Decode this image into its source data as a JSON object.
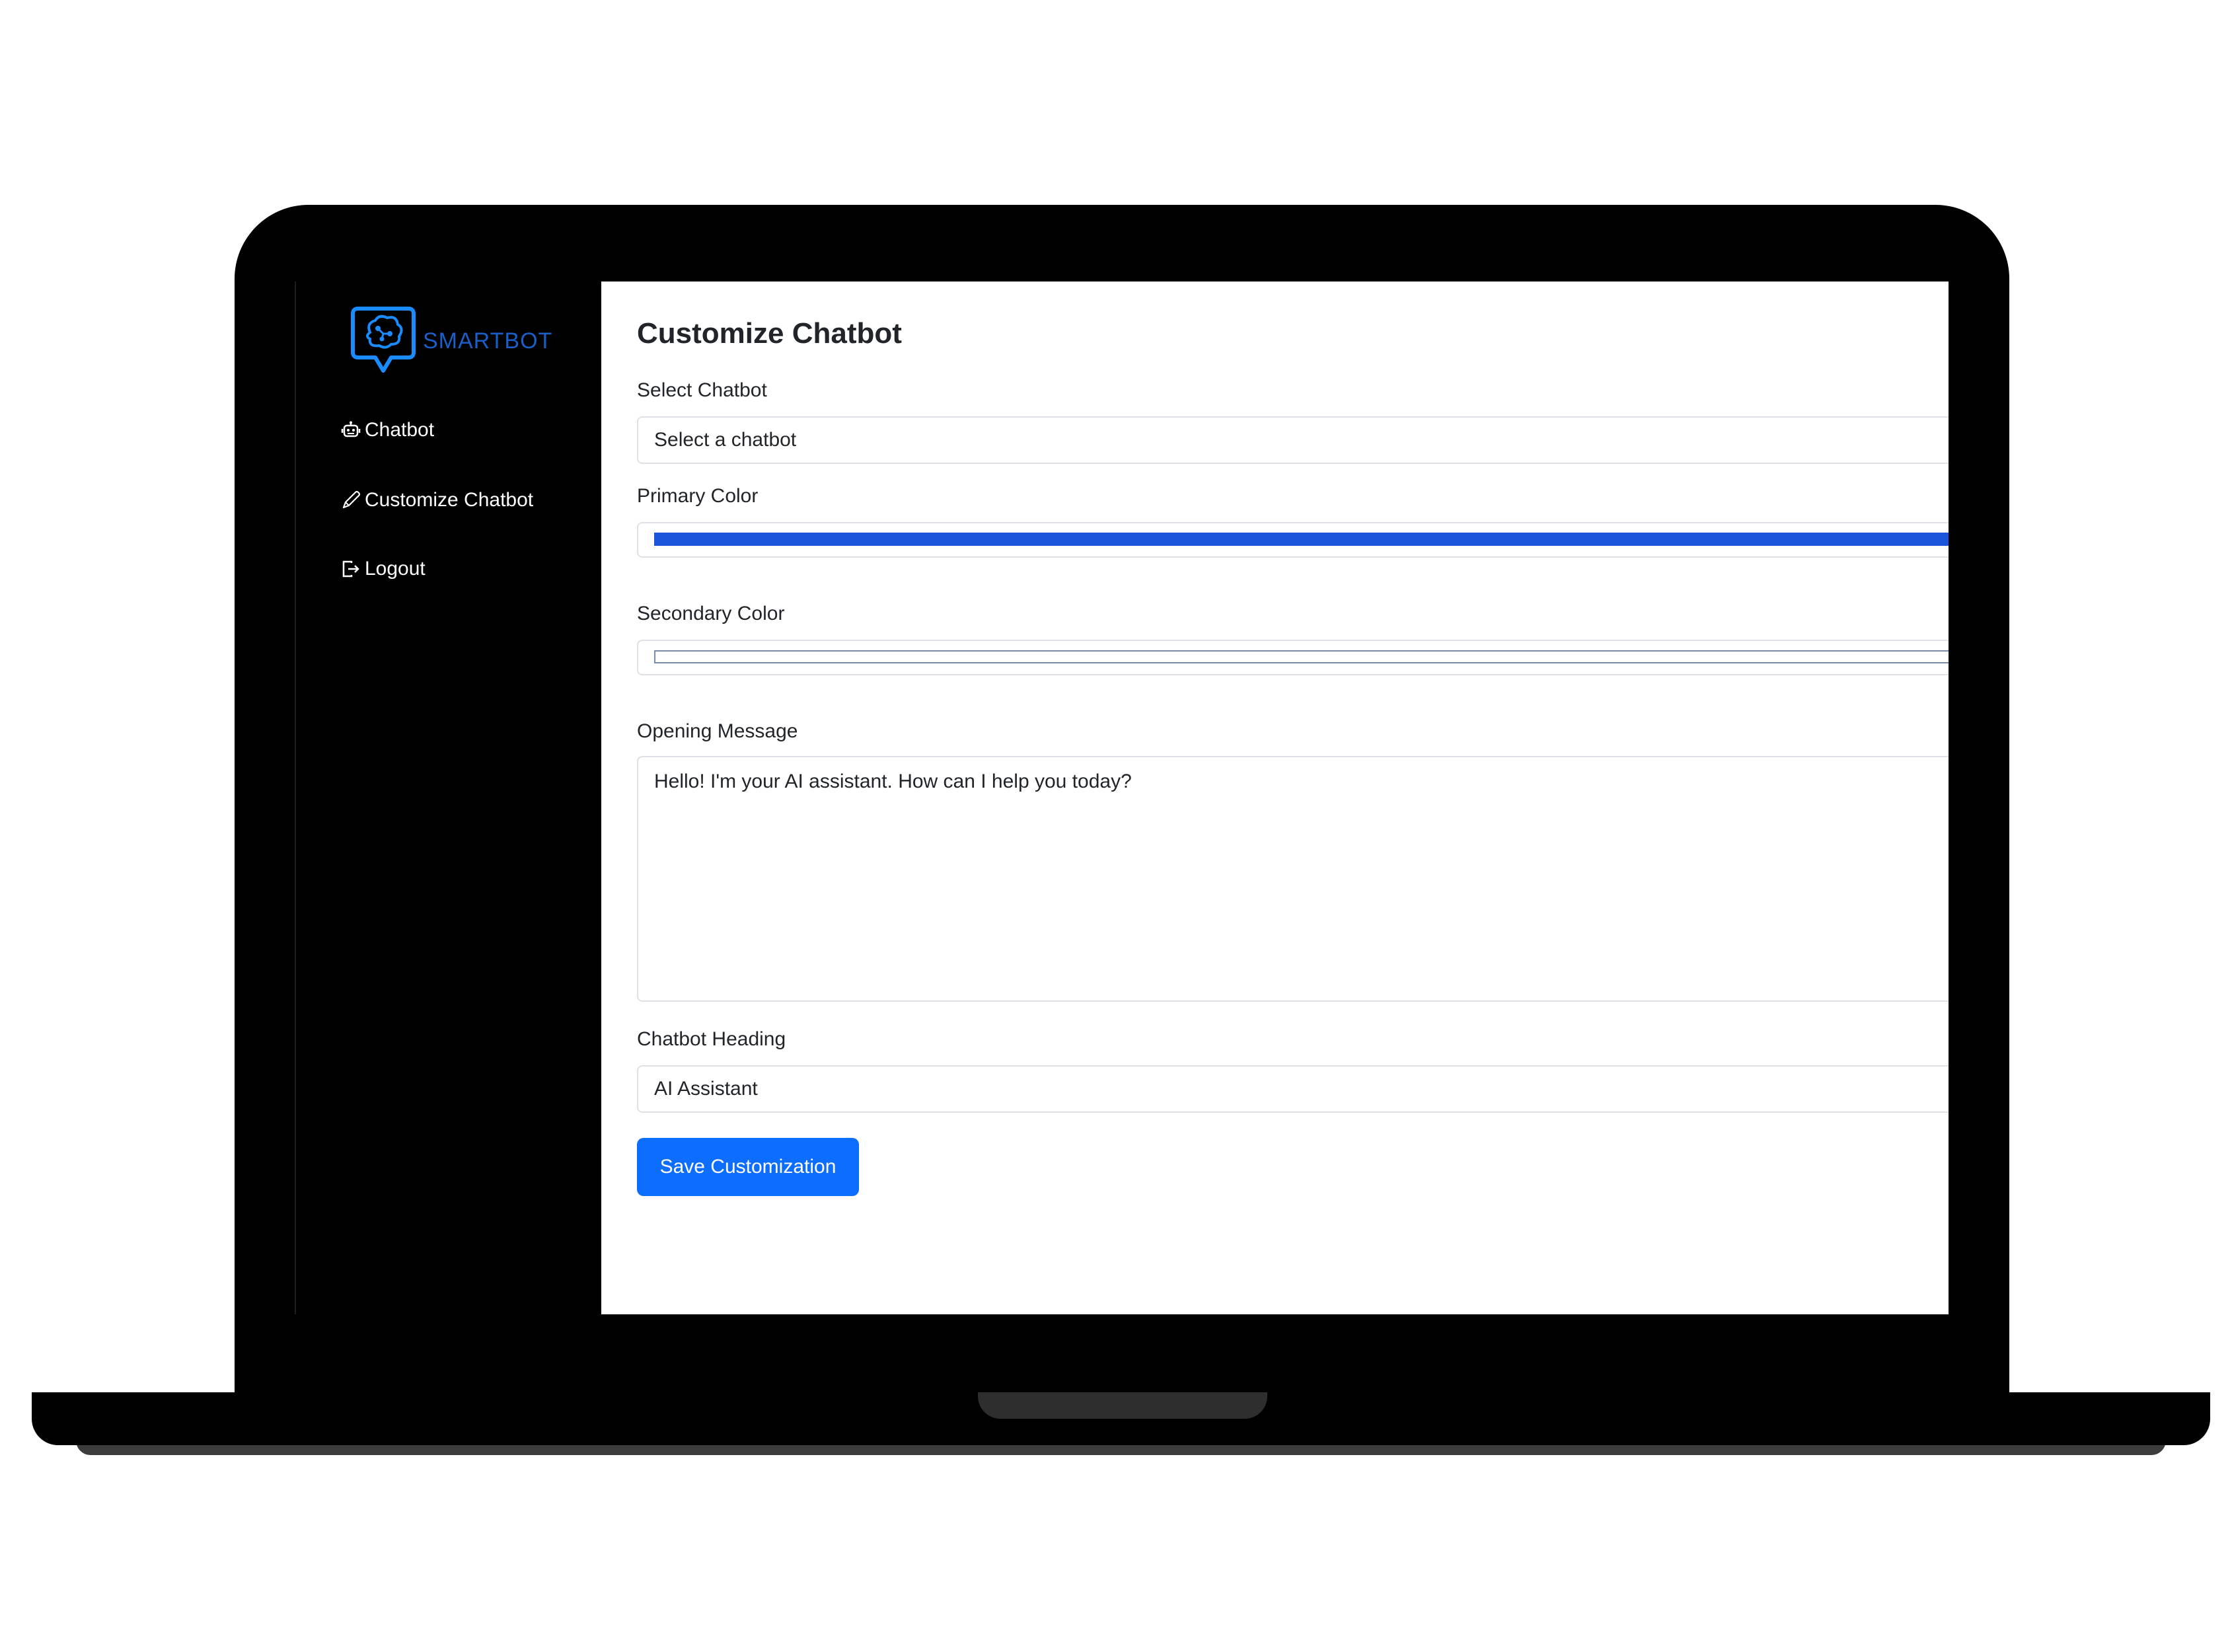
{
  "brand": {
    "name": "SMARTBOT",
    "color": "#1a5ec7"
  },
  "sidebar": {
    "items": [
      {
        "label": "Chatbot",
        "icon": "robot-icon"
      },
      {
        "label": "Customize Chatbot",
        "icon": "pencil-icon"
      },
      {
        "label": "Logout",
        "icon": "logout-icon"
      }
    ]
  },
  "page": {
    "title": "Customize Chatbot"
  },
  "form": {
    "select_chatbot": {
      "label": "Select Chatbot",
      "value": "Select a chatbot"
    },
    "primary_color": {
      "label": "Primary Color",
      "value": "#1a56db"
    },
    "secondary_color": {
      "label": "Secondary Color",
      "value": "#ffffff"
    },
    "opening_message": {
      "label": "Opening Message",
      "value": "Hello! I'm your AI assistant. How can I help you today?"
    },
    "chatbot_heading": {
      "label": "Chatbot Heading",
      "value": "AI Assistant"
    },
    "save_label": "Save Customization"
  },
  "colors": {
    "accent": "#0d6efd",
    "sidebar_bg": "#000000"
  }
}
